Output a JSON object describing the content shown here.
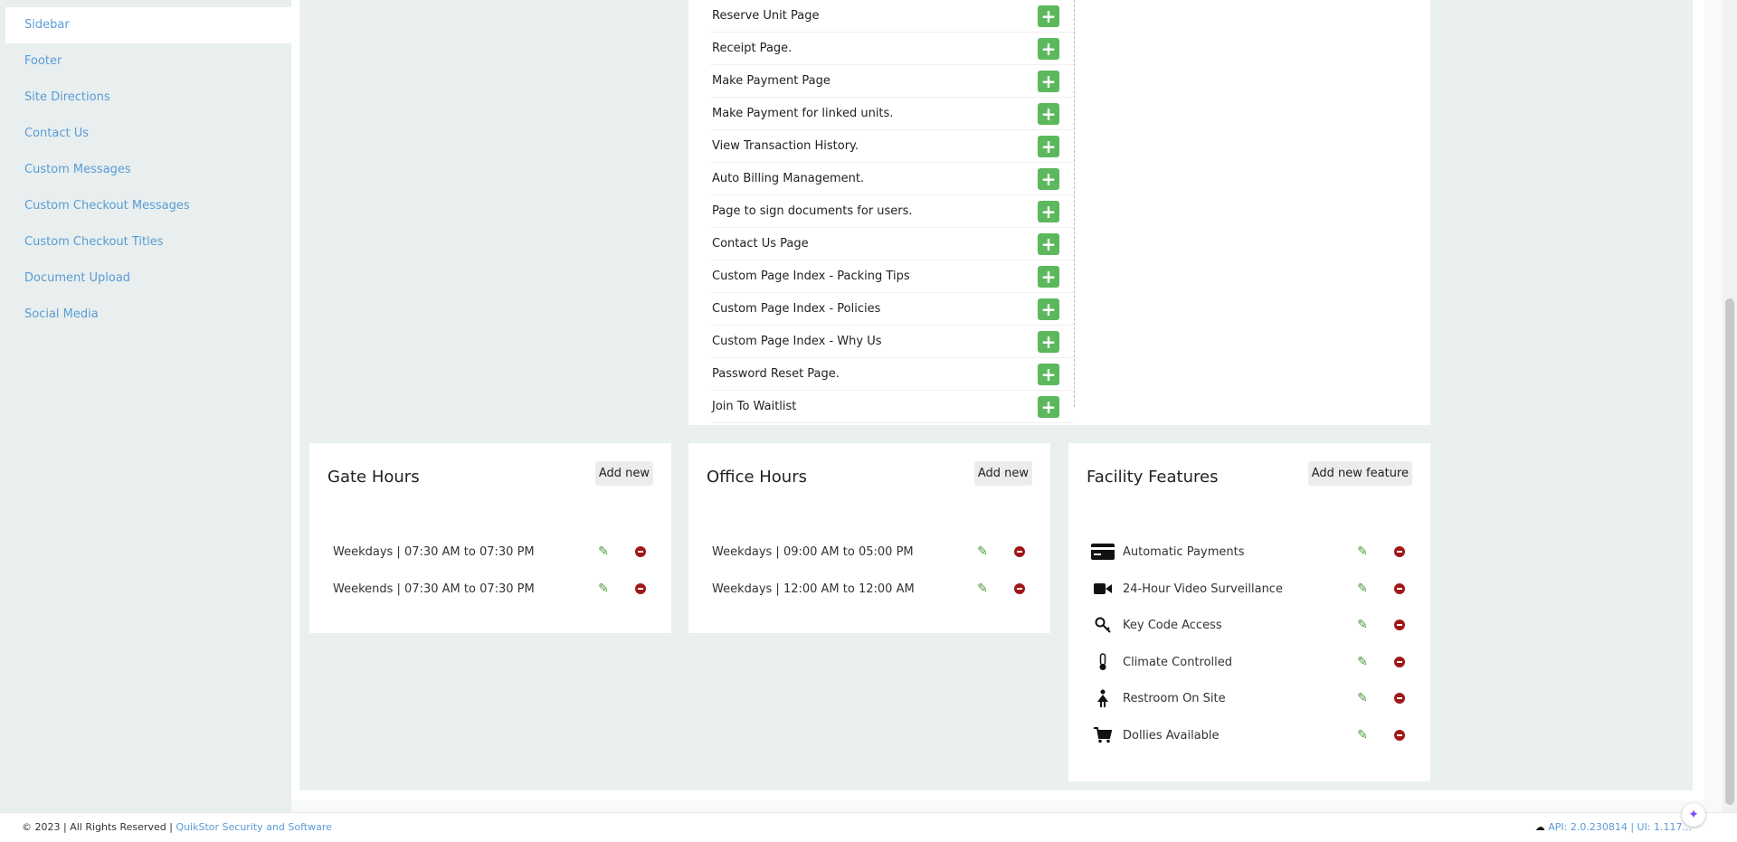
{
  "sidebar": {
    "items": [
      {
        "label": "Sidebar"
      },
      {
        "label": "Footer"
      },
      {
        "label": "Site Directions"
      },
      {
        "label": "Contact Us"
      },
      {
        "label": "Custom Messages"
      },
      {
        "label": "Custom Checkout Messages"
      },
      {
        "label": "Custom Checkout Titles"
      },
      {
        "label": "Document Upload"
      },
      {
        "label": "Social Media"
      }
    ]
  },
  "pages": [
    {
      "label": "Reserve Unit Page"
    },
    {
      "label": "Receipt Page."
    },
    {
      "label": "Make Payment Page"
    },
    {
      "label": "Make Payment for linked units."
    },
    {
      "label": "View Transaction History."
    },
    {
      "label": "Auto Billing Management."
    },
    {
      "label": "Page to sign documents for users."
    },
    {
      "label": "Contact Us Page"
    },
    {
      "label": "Custom Page Index - Packing Tips"
    },
    {
      "label": "Custom Page Index - Policies"
    },
    {
      "label": "Custom Page Index - Why Us"
    },
    {
      "label": "Password Reset Page."
    },
    {
      "label": "Join To Waitlist"
    }
  ],
  "gate_hours": {
    "title": "Gate Hours",
    "add_label": "Add new",
    "rows": [
      {
        "text": "Weekdays | 07:30 AM to 07:30 PM"
      },
      {
        "text": "Weekends | 07:30 AM to 07:30 PM"
      }
    ]
  },
  "office_hours": {
    "title": "Office Hours",
    "add_label": "Add new",
    "rows": [
      {
        "text": "Weekdays | 09:00 AM to 05:00 PM"
      },
      {
        "text": "Weekdays | 12:00 AM to 12:00 AM"
      }
    ]
  },
  "facility_features": {
    "title": "Facility Features",
    "add_label": "Add new feature",
    "rows": [
      {
        "text": "Automatic Payments",
        "icon": "credit-card-icon"
      },
      {
        "text": "24-Hour Video Surveillance",
        "icon": "video-camera-icon"
      },
      {
        "text": "Key Code Access",
        "icon": "key-icon"
      },
      {
        "text": "Climate Controlled",
        "icon": "thermometer-icon"
      },
      {
        "text": "Restroom On Site",
        "icon": "restroom-icon"
      },
      {
        "text": "Dollies Available",
        "icon": "cart-icon"
      }
    ]
  },
  "footer": {
    "copyright": "© 2023 | All Rights Reserved | ",
    "company": "QuikStor Security and Software",
    "version": "API: 2.0.230814 | UI: 1.117..."
  },
  "colors": {
    "accent_link": "#5b9bd5",
    "add_green": "#5cb85c",
    "remove_red": "#a01818",
    "edit_green": "#4a9a3a"
  }
}
